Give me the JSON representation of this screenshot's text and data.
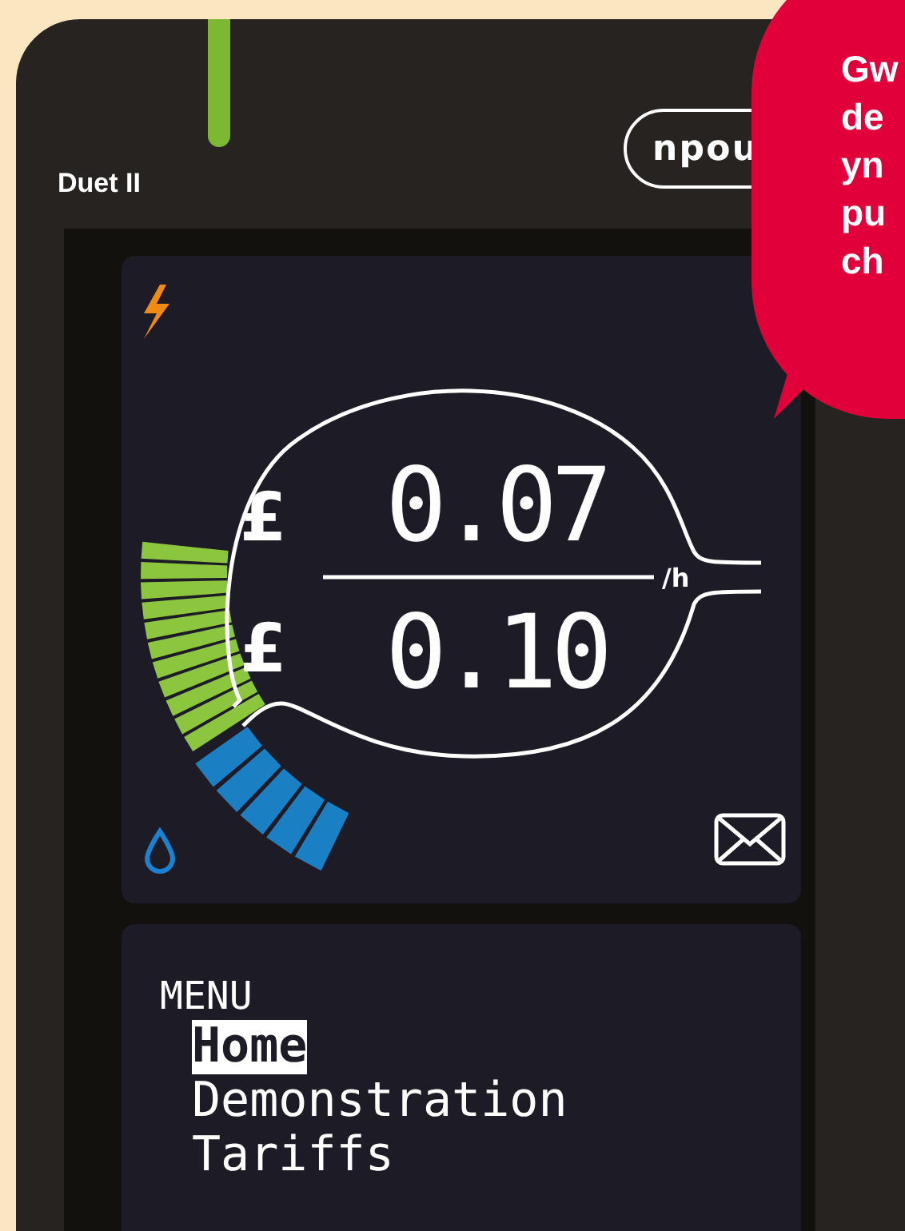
{
  "device": {
    "model": "Duet II",
    "logo": "npou"
  },
  "display": {
    "top_currency": "£",
    "top_value": "0.07",
    "bottom_currency": "£",
    "bottom_value": "0.10",
    "unit": "/h"
  },
  "menu": {
    "title": "MENU",
    "items": [
      {
        "label": "Home",
        "selected": true
      },
      {
        "label": "Demonstration",
        "selected": false
      },
      {
        "label": "Tariffs",
        "selected": false
      }
    ]
  },
  "callout": {
    "lines": [
      "Gw",
      "de",
      "yn",
      "pu",
      "ch"
    ]
  }
}
